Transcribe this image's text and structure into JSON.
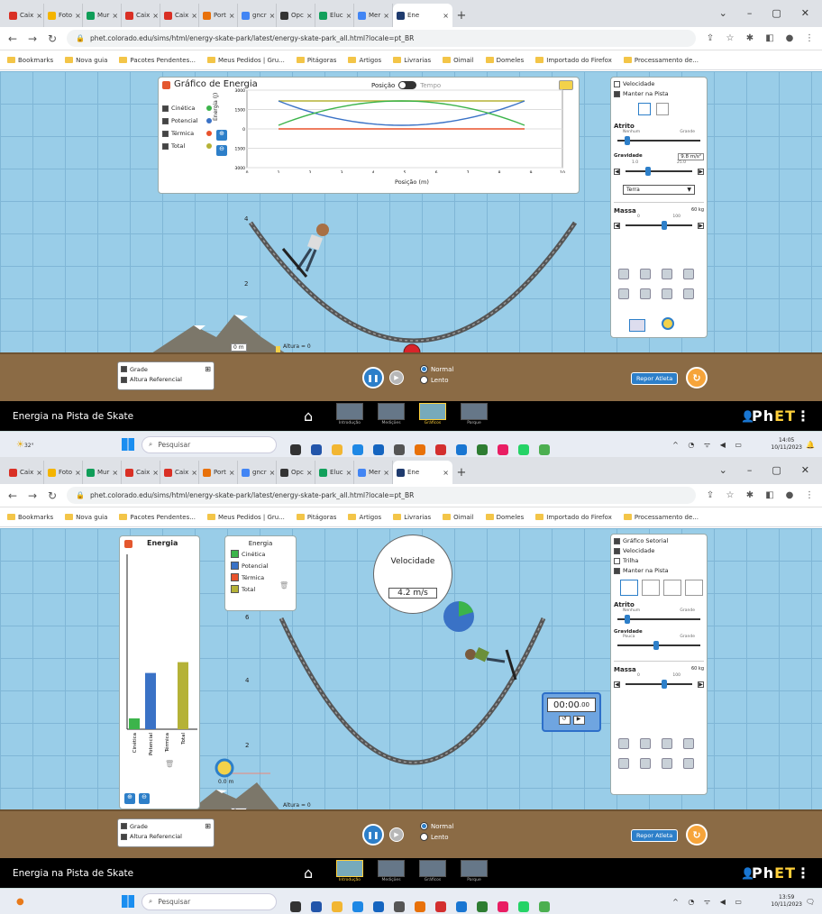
{
  "browser": {
    "tabs": [
      {
        "label": "Caix",
        "color": "#d93025"
      },
      {
        "label": "Foto",
        "color": "#f4b400"
      },
      {
        "label": "Mur",
        "color": "#0f9d58"
      },
      {
        "label": "Caix",
        "color": "#d93025"
      },
      {
        "label": "Caix",
        "color": "#d93025"
      },
      {
        "label": "Port",
        "color": "#e8710a"
      },
      {
        "label": "gncr",
        "color": "#4285f4"
      },
      {
        "label": "Opc",
        "color": "#333333"
      },
      {
        "label": "Eluc",
        "color": "#12a05c"
      },
      {
        "label": "Mer",
        "color": "#4285f4"
      },
      {
        "label": "Ene",
        "color": "#1f3b6e"
      }
    ],
    "bookmarks": [
      "Bookmarks",
      "Nova guia",
      "Pacotes Pendentes...",
      "Meus Pedidos | Gru...",
      "Pitágoras",
      "Artigos",
      "Livrarias",
      "Oimail",
      "Domeles",
      "Importado do Firefox",
      "Processamento de..."
    ]
  },
  "screens": [
    {
      "url": "phet.colorado.edu/sims/html/energy-skate-park/latest/energy-skate-park_all.html?locale=pt_BR",
      "graph": {
        "title": "Gráfico de Energia",
        "toggle_left": "Posição",
        "toggle_right": "Tempo",
        "checks": [
          "Cinética",
          "Potencial",
          "Térmica",
          "Total"
        ],
        "ylabel": "Energia (J)",
        "xlabel": "Posição (m)",
        "yticks": [
          "3000",
          "1500",
          "0",
          "-1500",
          "-3000"
        ],
        "xticks": [
          "0",
          "1",
          "2",
          "3",
          "4",
          "5",
          "6",
          "7",
          "8",
          "9",
          "10"
        ]
      },
      "right_panel": {
        "checks": [
          "Velocidade",
          "Manter na Pista"
        ],
        "atrito_label": "Atrito",
        "atrito_min": "Nenhum",
        "atrito_max": "Grande",
        "gravidade_label": "Gravidade",
        "gravidade_value": "9.8 m/s²",
        "gravidade_min": "1.0",
        "gravidade_max": "25.0",
        "planet": "Terra",
        "massa_label": "Massa",
        "massa_value": "60 kg",
        "massa_min": "0",
        "massa_max": "100"
      },
      "track_labels": [
        "4",
        "2"
      ],
      "height_label": "Altura = 0",
      "zero_label": "0 m",
      "bottom": {
        "grid": "Grade",
        "ref_height": "Altura Referencial",
        "speed_normal": "Normal",
        "speed_slow": "Lento",
        "reset_label": "Repor Atleta"
      },
      "phet": {
        "sim_title": "Energia na Pista de Skate",
        "screens": [
          "Introdução",
          "Medições",
          "Gráficos",
          "Parque"
        ],
        "selected": 2
      },
      "taskbar": {
        "search": "Pesquisar",
        "time": "14:05",
        "date": "10/11/2023",
        "temp": "32°"
      }
    },
    {
      "url": "phet.colorado.edu/sims/html/energy-skate-park/latest/energy-skate-park_all.html?locale=pt_BR",
      "energy_panel": {
        "title": "Energia",
        "legend_title": "Energia",
        "legend": [
          "Cinética",
          "Potencial",
          "Térmica",
          "Total"
        ],
        "bars": [
          "Cinética",
          "Potencial",
          "Térmica",
          "Total"
        ]
      },
      "speedometer": {
        "title": "Velocidade",
        "value": "4.2 m/s"
      },
      "timer": {
        "value": "00:00",
        "ms": ".00"
      },
      "right_panel": {
        "checks": [
          "Gráfico Setorial",
          "Velocidade",
          "Trilha",
          "Manter na Pista"
        ],
        "atrito_label": "Atrito",
        "atrito_min": "Nenhum",
        "atrito_max": "Grande",
        "gravidade_label": "Gravidade",
        "gravidade_min": "Pouca",
        "gravidade_max": "Grande",
        "massa_label": "Massa",
        "massa_value": "60 kg",
        "massa_min": "0",
        "massa_max": "100"
      },
      "track_labels": [
        "6",
        "4",
        "2"
      ],
      "height_label": "Altura = 0",
      "zero_label": "0 m",
      "tape_label": "0.0 m",
      "bottom": {
        "grid": "Grade",
        "ref_height": "Altura Referencial",
        "speed_normal": "Normal",
        "speed_slow": "Lento",
        "reset_label": "Repor Atleta"
      },
      "phet": {
        "sim_title": "Energia na Pista de Skate",
        "screens": [
          "Introdução",
          "Medições",
          "Gráficos",
          "Parque"
        ],
        "selected": 0
      },
      "taskbar": {
        "search": "Pesquisar",
        "time": "13:59",
        "date": "10/11/2023"
      }
    }
  ],
  "colors": {
    "kinetic": "#3cb44b",
    "potential": "#3a72c6",
    "thermal": "#e8522c",
    "total": "#b5b237",
    "sky": "#99cde8",
    "ground": "#8b6b45"
  }
}
